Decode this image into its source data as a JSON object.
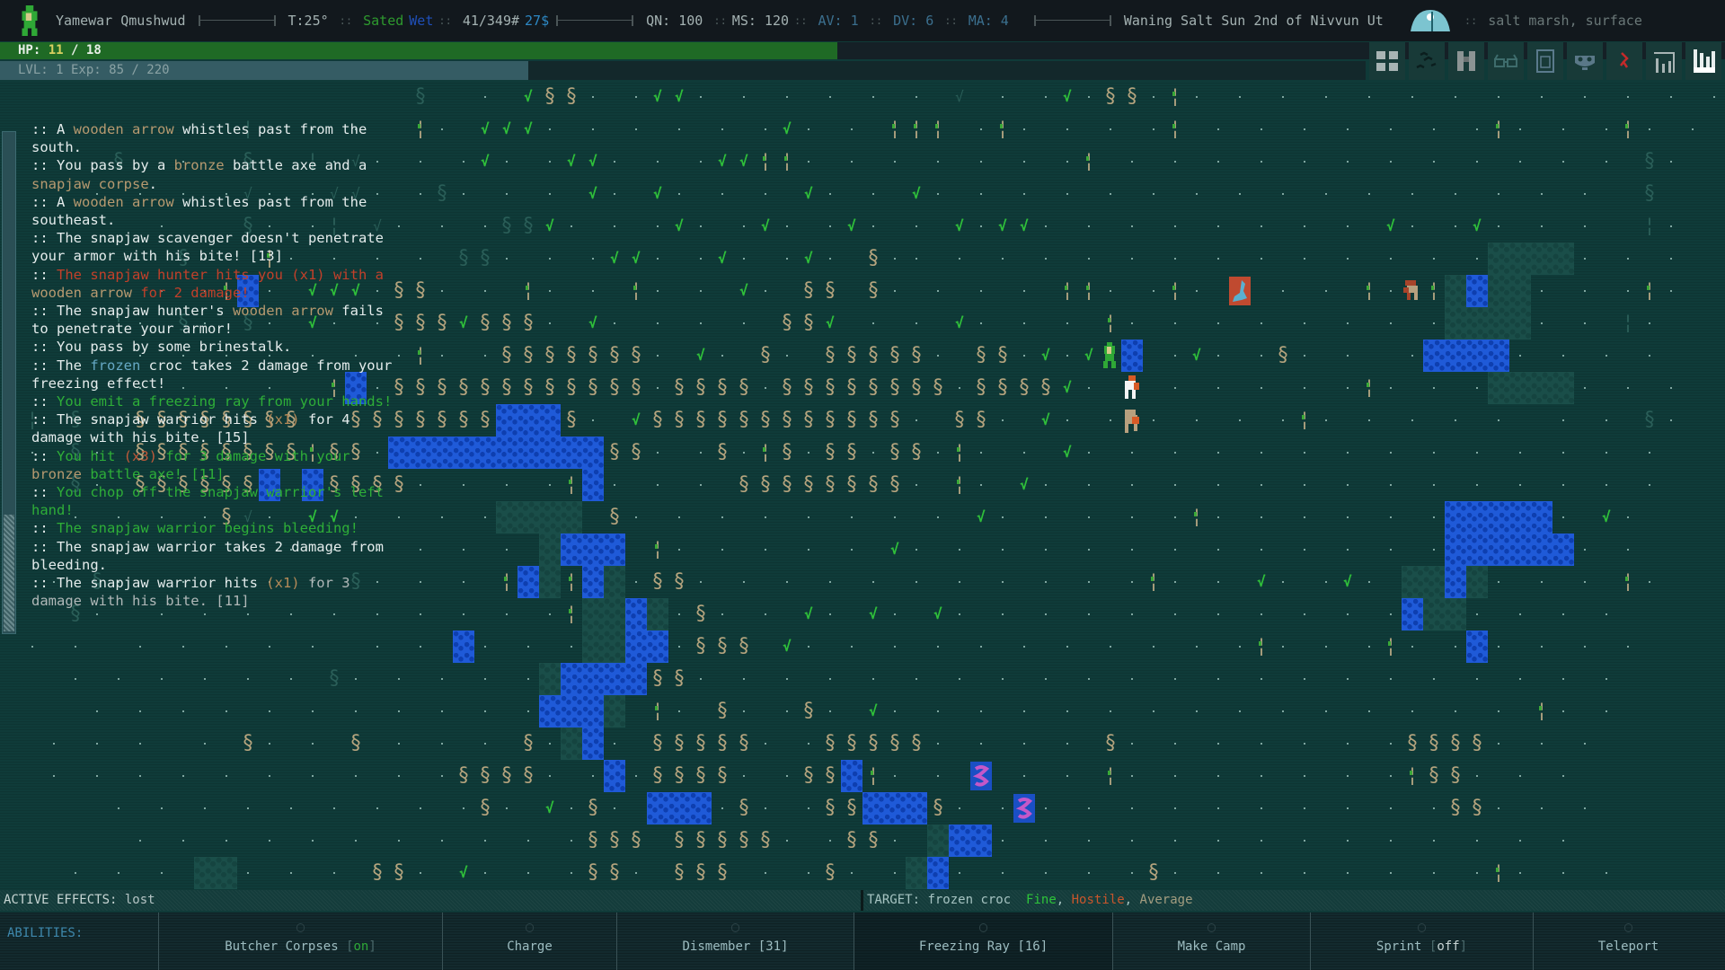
{
  "topbar": {
    "player_name": "Yamewar Qmushwud",
    "temperature": "T:25°",
    "hunger": "Sated",
    "wet_status": "Wet",
    "weight": "41/349#",
    "money": "27$",
    "quickness": "QN: 100",
    "move_speed": "MS: 120",
    "armor_value": "AV: 1",
    "dodge_value": "DV: 6",
    "mental_armor": "MA: 4",
    "date": "Waning Salt Sun 2nd of Nivvun Ut",
    "location": "salt marsh, surface",
    "separator": "::"
  },
  "hp": {
    "label": "HP:",
    "current": "11",
    "slash": "/",
    "max": "18",
    "fraction": 0.61
  },
  "xp": {
    "text": "LVL: 1 Exp: 85 / 220",
    "fraction": 0.386
  },
  "toolbar": [
    {
      "name": "grid-view-icon"
    },
    {
      "name": "map-trail-icon"
    },
    {
      "name": "binoculars-icon"
    },
    {
      "name": "glasses-icon"
    },
    {
      "name": "journal-icon"
    },
    {
      "name": "mask-icon"
    },
    {
      "name": "red-symbol-icon"
    },
    {
      "name": "stats-bars-icon"
    },
    {
      "name": "bar-chart-icon"
    }
  ],
  "log": [
    [
      {
        "t": ":: A "
      },
      {
        "t": "wooden arrow",
        "c": "item"
      },
      {
        "t": " whistles past from the"
      }
    ],
    [
      {
        "t": "south."
      }
    ],
    [
      {
        "t": ":: You pass by a "
      },
      {
        "t": "bronze",
        "c": "item"
      },
      {
        "t": " battle axe and a"
      }
    ],
    [
      {
        "t": "snapjaw corpse",
        "c": "item"
      },
      {
        "t": "."
      }
    ],
    [
      {
        "t": ":: A "
      },
      {
        "t": "wooden arrow",
        "c": "item"
      },
      {
        "t": " whistles past from the"
      }
    ],
    [
      {
        "t": "southeast."
      }
    ],
    [
      {
        "t": ":: The snapjaw scavenger doesn't penetrate"
      }
    ],
    [
      {
        "t": "your armor with his bite! [13]"
      }
    ],
    [
      {
        "t": ":: "
      },
      {
        "t": "The snapjaw hunter hits you (x1) with a",
        "c": "red"
      }
    ],
    [
      {
        "t": "wooden arrow",
        "c": "item"
      },
      {
        "t": " for 2 damage!",
        "c": "red"
      }
    ],
    [
      {
        "t": ":: The snapjaw hunter's "
      },
      {
        "t": "wooden arrow",
        "c": "item"
      },
      {
        "t": " fails"
      }
    ],
    [
      {
        "t": "to penetrate your armor!"
      }
    ],
    [
      {
        "t": ":: You pass by some brinestalk."
      }
    ],
    [
      {
        "t": ":: The "
      },
      {
        "t": "frozen",
        "c": "cyan"
      },
      {
        "t": " croc takes 2 damage from your"
      }
    ],
    [
      {
        "t": "freezing effect!"
      }
    ],
    [
      {
        "t": ":: "
      },
      {
        "t": "You emit a freezing ray from your hands!",
        "c": "green"
      }
    ],
    [
      {
        "t": ":: The snapjaw warrior hits "
      },
      {
        "t": "(x1)",
        "c": "paren"
      },
      {
        "t": " for 4"
      }
    ],
    [
      {
        "t": "damage with his bite. [15]"
      }
    ],
    [
      {
        "t": ":: "
      },
      {
        "t": "You hit ",
        "c": "green"
      },
      {
        "t": "(x3)",
        "c": "dmg"
      },
      {
        "t": " for 3 damage with your",
        "c": "green"
      }
    ],
    [
      {
        "t": "bronze",
        "c": "item"
      },
      {
        "t": " battle axe! [11]",
        "c": "green"
      }
    ],
    [
      {
        "t": ":: "
      },
      {
        "t": "You chop off the snapjaw warrior's left",
        "c": "green"
      }
    ],
    [
      {
        "t": "hand!",
        "c": "green"
      }
    ],
    [
      {
        "t": ":: "
      },
      {
        "t": "The snapjaw warrior begins bleeding!",
        "c": "green"
      }
    ],
    [
      {
        "t": ":: The snapjaw warrior takes 2 damage from"
      }
    ],
    [
      {
        "t": "bleeding."
      }
    ],
    [
      {
        "t": ":: The snapjaw warrior hits "
      },
      {
        "t": "(x1)",
        "c": "paren"
      },
      {
        "t": " for 3",
        "c": "dim"
      }
    ],
    [
      {
        "t": "damage with his bite. [11]",
        "c": "dim"
      }
    ]
  ],
  "map": {
    "legend": {
      ".": "dot",
      "v": "grass",
      "w": "reed",
      "b": "stalk",
      "W": "water",
      "D": "dwater",
      "g": "dgrass",
      "r": "dreed",
      "s": "dstalk",
      " ": "empty"
    },
    "rows": [
      "                   r  . vww. .vv. . . . . . g . .v.ww.b. . . . . . . . . . . . .",
      "           s  . .  b. vvv. . . . . .v. . bbb .b. . . .b . . . . . . .b. . .b. . ",
      "     r  .  r. s.g. . .v. .vv. . .vvbb. . . . . . .b . . . . . . . . . . . . r.  ",
      "    . . . .g. .gg. .r. . . v. v. . . v. . v. . . . . . . . . . . . . . . .  r  ",
      "       .   r. .s g. . .rrv. . .v. .v. .v. . v.vv. . . . . . . . v. .v. . .  s. ",
      "        r.  b. . . . rr. . .vv. .v. .v. w.. . . . . . . . . . . . . .DDDD. . . ",
      "       . .bW. vvv.ww. . b. . b. . v. ww w. . . . bb. .b. . . . b. bDWDD. . .b. ",
      "     s. r. r. v. .wwwvwww. v. . . . wwv . . v. . . b. . . . . . . .DDDD. . s. ",
      "      . . . . . . .b. .wwwwwww. v. w. wwwww. ww.v.v W .v. .w. .  .WWWW. . . . ",
      "    . . . . .  bW.wwwwwwwwwwww.wwww.wwwwwwww.wwwwv. . . . . . .b. . .DDDD. . . ",
      " s r. wwwwwwww. wwwwwwwWWWw. vwwwwwwwwwwww. ww. v. . . . . .b. . . . .  . . r. ",
      " . r. wwwwwwwwbww.WWWWWWWWWWww. .w.bw.ww.ww.b. . v. . . . . . . . . . . . . . ",
      "   r. wwwwwwW Wwwww. . . .bW. . . wwwwwwww. b. v. . . . . . . . . . . . . . . ",
      "   . . . .wg. vv. . . .DDDD w. . . . . . . . v. . . . .b. . . . . .WWWWW. v. ",
      "    . .  . . . . . . . . DWWW b. . . . . v. . . . . . . . . . . . .WWWWWW. . ",
      "  . r.  . . . . r. . . bWDbWD.ww. . . . . . . . . . .b. . v. .v. DDWD. . . b. ",
      "   r.  . . . . . . . . . .bDDWD.w. . v. v. v. . . . . . . . . . .WDD. . . . ",
      " . .  . . . . .  . . W. . .DDWW.www v. . . . . . . . . . .b. . .b. .W. . . . ",
      "   . . . . . . r. . . . .DWWWWww. . . . . . . . . . . . . . . . . . . . . . ",
      "    . . . . . . . . . . .WWWD b. w. .w. v. . . . . . . . . . . . . . . b. . ",
      "  . . .  . w. . w . . . w.DW. wwwww. .wwwww. . . . w. . . . . . .wwww. . . ",
      "  . . . . . . . . . .wwww. .W.wwww. .wwWb. . . . . b. . . . . . .bww. . . ",
      "     . . . . . . . . .w. v.w. WWW.w. .wwWWWw. . . . . . . . . . . .ww. . . ",
      "      . . . . . . . . . . .www wwwww. .ww. DWW. . . . . . . . . . . . . . ",
      "   . . . DD. . . ww. v. . .ww. www . .w. .DW. . . . .w. . . . . . . .b. . . "
    ]
  },
  "creatures": [
    {
      "name": "player",
      "col": 51,
      "row": 8,
      "type": "player"
    },
    {
      "name": "snapjaw-warrior",
      "col": 52,
      "row": 9,
      "type": "snapjaw-white"
    },
    {
      "name": "snapjaw-scavenger",
      "col": 52,
      "row": 10,
      "type": "snapjaw-tan"
    },
    {
      "name": "frozen-croc",
      "col": 57,
      "row": 6,
      "type": "croc"
    },
    {
      "name": "snapjaw-hunter",
      "col": 65,
      "row": 6,
      "type": "snapjaw-red"
    },
    {
      "name": "eel-1",
      "col": 45,
      "row": 21,
      "type": "eel"
    },
    {
      "name": "eel-2",
      "col": 47,
      "row": 22,
      "type": "eel"
    }
  ],
  "status": {
    "effects_label": "ACTIVE EFFECTS:",
    "effects_value": "lost",
    "target_label": "TARGET:",
    "target_name": "frozen croc",
    "target_health": "Fine",
    "target_attitude": "Hostile",
    "target_difficulty": "Average",
    "comma": ","
  },
  "abilities": {
    "label": "ABILITIES:",
    "items": [
      {
        "name": "Butcher Corpses",
        "toggle": "on"
      },
      {
        "name": "Charge"
      },
      {
        "name": "Dismember [31]"
      },
      {
        "name": "Freezing Ray [16]",
        "active": true
      },
      {
        "name": "Make Camp"
      },
      {
        "name": "Sprint",
        "toggle": "off"
      },
      {
        "name": "Teleport"
      }
    ]
  },
  "colors": {
    "hp_bar": "#1f6a25",
    "xp_bar": "#355c64",
    "water": "#1f5ad8",
    "map_bg": "#0f3b39"
  }
}
